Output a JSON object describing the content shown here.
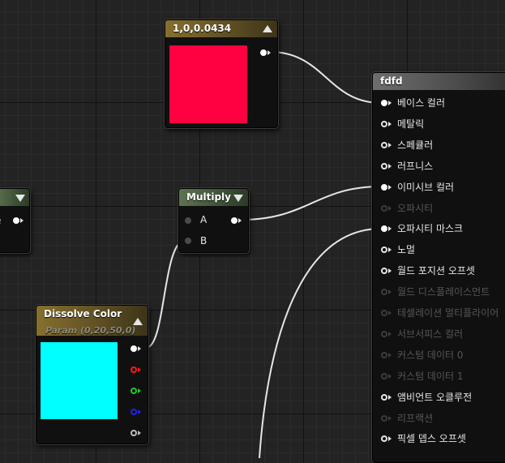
{
  "colors": {
    "wire": "#e6e6e6",
    "constant_swatch": "#ff0040",
    "dissolve_swatch": "#00ffff",
    "pin_red": "#ff1a1a",
    "pin_green": "#22cc22",
    "pin_blue": "#2222ee"
  },
  "constant_node": {
    "title": "1,0,0.0434"
  },
  "multiply_node": {
    "title": "Multiply",
    "inputs": [
      "A",
      "B"
    ]
  },
  "left_node": {
    "output_label_fragment": "e"
  },
  "dissolve_node": {
    "title": "Dissolve Color",
    "subtitle": "Param (0,20,50,0)"
  },
  "material_node": {
    "title": "fdfd",
    "inputs": [
      {
        "label": "베이스 컬러",
        "connected": true,
        "enabled": true
      },
      {
        "label": "메탈릭",
        "connected": false,
        "enabled": true
      },
      {
        "label": "스페큘러",
        "connected": false,
        "enabled": true
      },
      {
        "label": "러프니스",
        "connected": false,
        "enabled": true
      },
      {
        "label": "이미시브 컬러",
        "connected": true,
        "enabled": true
      },
      {
        "label": "오파시티",
        "connected": false,
        "enabled": false
      },
      {
        "label": "오파시티 마스크",
        "connected": true,
        "enabled": true
      },
      {
        "label": "노멀",
        "connected": false,
        "enabled": true
      },
      {
        "label": "월드 포지션 오프셋",
        "connected": false,
        "enabled": true
      },
      {
        "label": "월드 디스플레이스먼트",
        "connected": false,
        "enabled": false
      },
      {
        "label": "테셀레이션 멀티플라이어",
        "connected": false,
        "enabled": false
      },
      {
        "label": "서브서피스 컬러",
        "connected": false,
        "enabled": false
      },
      {
        "label": "커스텀 데이터 0",
        "connected": false,
        "enabled": false
      },
      {
        "label": "커스텀 데이터 1",
        "connected": false,
        "enabled": false
      },
      {
        "label": "앰비언트 오클루전",
        "connected": false,
        "enabled": true
      },
      {
        "label": "리프랙션",
        "connected": false,
        "enabled": false
      },
      {
        "label": "픽셀 뎁스 오프셋",
        "connected": false,
        "enabled": true
      }
    ]
  }
}
